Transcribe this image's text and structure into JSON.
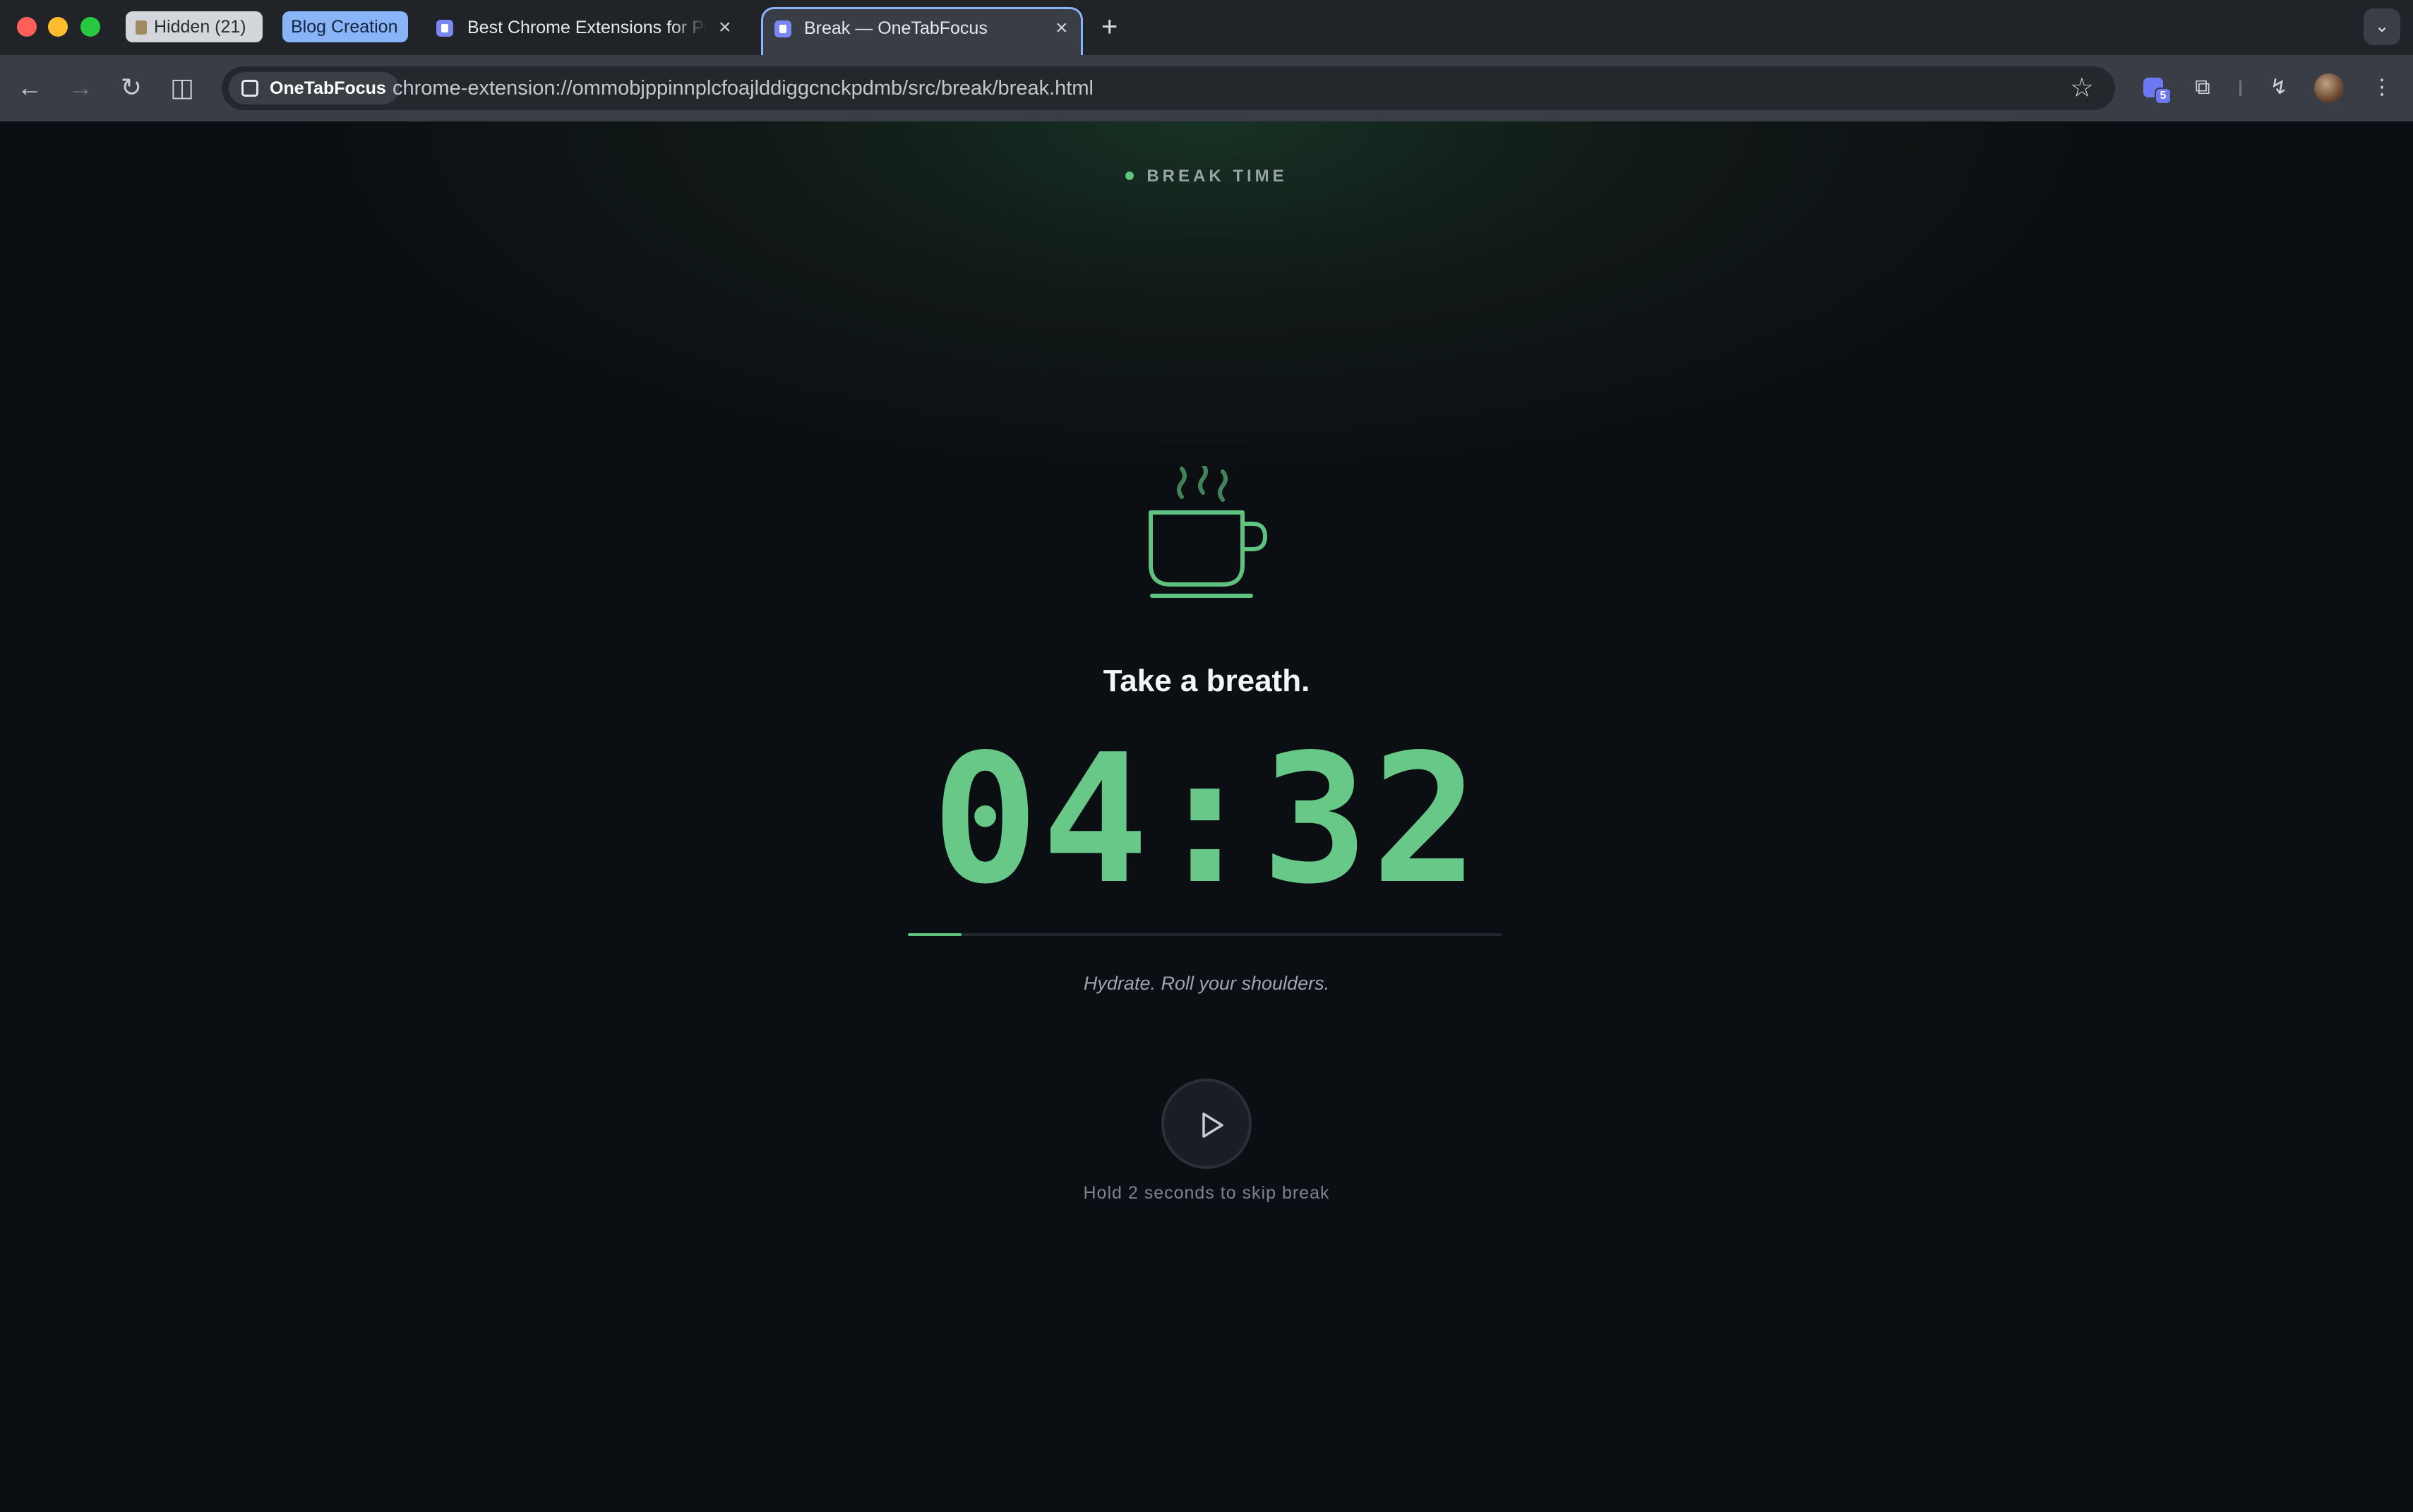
{
  "browser": {
    "tab_groups": [
      {
        "label": "Hidden (21)"
      },
      {
        "label": "Blog Creation"
      }
    ],
    "tabs": [
      {
        "title": "Best Chrome Extensions for Productivity",
        "active": false
      },
      {
        "title": "Break — OneTabFocus",
        "active": true
      }
    ],
    "new_tab_label": "+",
    "tab_search_label": "⌄",
    "site_chip_label": "OneTabFocus",
    "url": "chrome-extension://ommobjppinnplcfoajlddiggcnckpdmb/src/break/break.html",
    "extension_badge": "5",
    "icons": {
      "back": "←",
      "forward": "→",
      "reload": "↻",
      "split": "◫",
      "star": "☆",
      "puzzle": "⧉",
      "lightning": "↯",
      "kebab": "⋮"
    }
  },
  "page": {
    "break_label": "BREAK TIME",
    "headline": "Take a breath.",
    "timer": "04:32",
    "progress_fraction": 0.09,
    "tip": "Hydrate. Roll your shoulders.",
    "skip_hint": "Hold 2 seconds to skip break",
    "accent_color": "#5fc27e",
    "timer_color": "#67c887"
  }
}
